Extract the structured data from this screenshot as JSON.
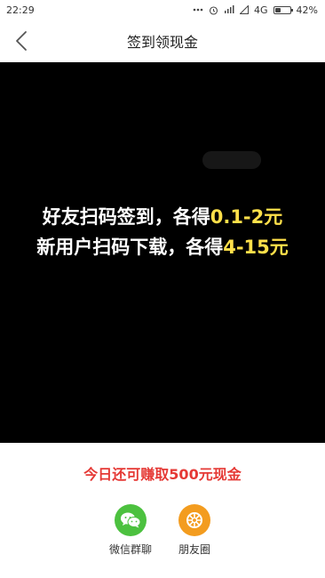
{
  "status_bar": {
    "time": "22:29",
    "network": "4G",
    "battery_percent": "42%",
    "battery_level": 0.42
  },
  "nav": {
    "title": "签到领现金"
  },
  "poster": {
    "line1_prefix": "好友扫码签到，各得",
    "line1_highlight": "0.1-2元",
    "line2_prefix": "新用户扫码下载，各得",
    "line2_highlight": "4-15元",
    "highlight_color": "#ffe04a"
  },
  "footer": {
    "prompt": "今日还可赚取500元现金",
    "share_options": [
      {
        "label": "微信群聊",
        "icon": "wechat-icon",
        "color": "#4cc13f"
      },
      {
        "label": "朋友圈",
        "icon": "moments-icon",
        "color": "#f39c1f"
      }
    ]
  },
  "colors": {
    "accent_red": "#e53935"
  }
}
